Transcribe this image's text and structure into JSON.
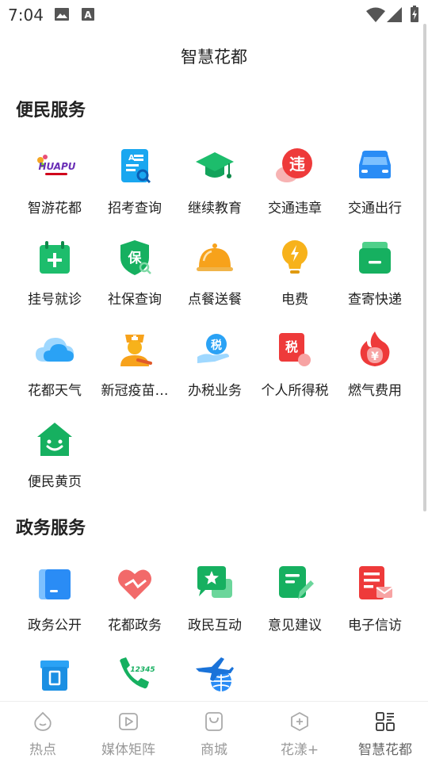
{
  "status_bar": {
    "time": "7:04"
  },
  "header": {
    "title": "智慧花都"
  },
  "sections": {
    "convenience": {
      "title": "便民服务",
      "items": [
        {
          "label": "智游花都",
          "icon": "huapu-logo-icon",
          "logo_text": "HUAPU"
        },
        {
          "label": "招考查询",
          "icon": "exam-doc-icon"
        },
        {
          "label": "继续教育",
          "icon": "graduation-cap-icon"
        },
        {
          "label": "交通违章",
          "icon": "traffic-violation-icon",
          "glyph": "违"
        },
        {
          "label": "交通出行",
          "icon": "car-icon"
        },
        {
          "label": "挂号就诊",
          "icon": "medical-calendar-icon"
        },
        {
          "label": "社保查询",
          "icon": "social-security-shield-icon",
          "glyph": "保"
        },
        {
          "label": "点餐送餐",
          "icon": "food-cloche-icon"
        },
        {
          "label": "电费",
          "icon": "lightbulb-icon"
        },
        {
          "label": "查寄快递",
          "icon": "parcel-icon"
        },
        {
          "label": "花都天气",
          "icon": "cloud-icon"
        },
        {
          "label": "新冠疫苗…",
          "icon": "vaccine-doctor-icon"
        },
        {
          "label": "办税业务",
          "icon": "tax-hand-icon",
          "glyph": "税"
        },
        {
          "label": "个人所得税",
          "icon": "income-tax-icon",
          "glyph": "税"
        },
        {
          "label": "燃气费用",
          "icon": "gas-flame-icon",
          "glyph": "¥"
        },
        {
          "label": "便民黄页",
          "icon": "smiling-house-icon"
        }
      ]
    },
    "government": {
      "title": "政务服务",
      "items": [
        {
          "label": "政务公开",
          "icon": "gov-open-icon"
        },
        {
          "label": "花都政务",
          "icon": "heart-icon"
        },
        {
          "label": "政民互动",
          "icon": "star-chat-icon"
        },
        {
          "label": "意见建议",
          "icon": "suggestion-note-icon"
        },
        {
          "label": "电子信访",
          "icon": "letter-doc-icon"
        },
        {
          "label": "",
          "icon": "document-box-icon"
        },
        {
          "label": "",
          "icon": "hotline-phone-icon",
          "glyph": "12345"
        },
        {
          "label": "",
          "icon": "airplane-globe-icon"
        }
      ]
    }
  },
  "bottom_nav": {
    "items": [
      {
        "label": "热点",
        "icon": "hot-spot-icon"
      },
      {
        "label": "媒体矩阵",
        "icon": "video-play-icon"
      },
      {
        "label": "商城",
        "icon": "shopping-bag-icon"
      },
      {
        "label": "花漾+",
        "icon": "hexagon-plus-icon"
      },
      {
        "label": "智慧花都",
        "icon": "grid-apps-icon",
        "active": true
      }
    ]
  }
}
